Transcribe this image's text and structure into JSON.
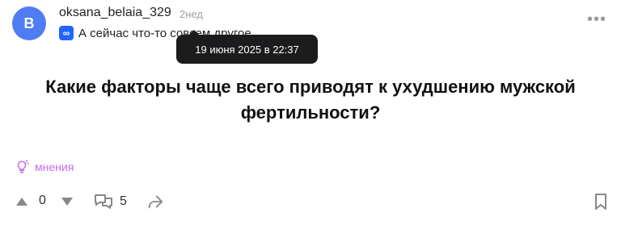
{
  "post": {
    "author": {
      "avatar_letter": "B",
      "username": "oksana_belaia_329",
      "time_ago": "2нед",
      "status_badge": "∞",
      "status_text": "А сейчас что-то совсем другое"
    },
    "tooltip_text": "19 июня 2025 в 22:37",
    "question": "Какие факторы чаще всего приводят к ухудшению мужской фертильности?",
    "opinions_label": "мнения",
    "votes": "0",
    "comments_count": "5"
  },
  "colors": {
    "avatar": "#4f7cf3",
    "badge": "#1f66ff",
    "opinions_accent": "#c46ce8",
    "tooltip_bg": "#1c1c1e"
  },
  "icons": [
    "more-icon",
    "lightbulb-icon",
    "upvote-icon",
    "downvote-icon",
    "comment-icon",
    "share-icon",
    "bookmark-icon"
  ]
}
